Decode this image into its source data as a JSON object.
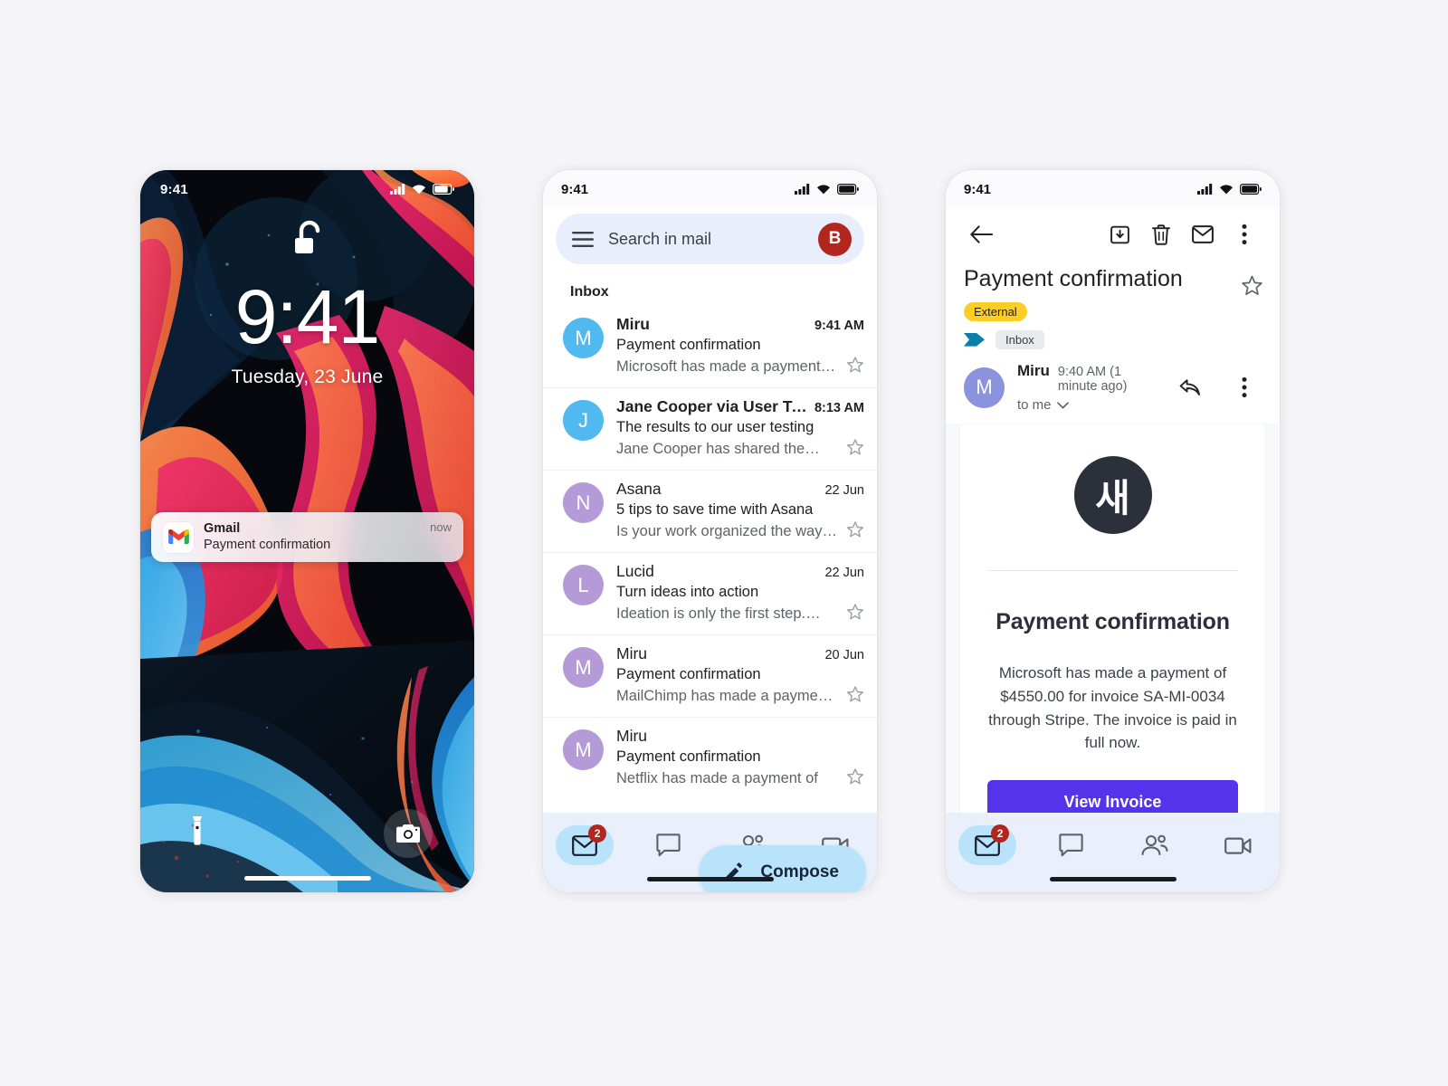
{
  "canvas": {
    "background": "#f5f5f8"
  },
  "phone_lock": {
    "name": "lock-screen",
    "status": {
      "time": "9:41",
      "icons": [
        "cellular-icon",
        "wifi-icon",
        "battery-icon"
      ]
    },
    "lock_icon": "unlocked-padlock-icon",
    "clock": "9:41",
    "date": "Tuesday, 23 June",
    "notification": {
      "app": "Gmail",
      "app_icon": "gmail-icon",
      "title": "Payment confirmation",
      "time": "now"
    },
    "shortcuts": {
      "left": "flashlight-icon",
      "right": "camera-icon"
    }
  },
  "phone_inbox": {
    "name": "gmail-inbox",
    "status": {
      "time": "9:41",
      "icons": [
        "cellular-icon",
        "wifi-icon",
        "battery-icon"
      ]
    },
    "search": {
      "menu_icon": "hamburger-menu-icon",
      "placeholder": "Search in mail",
      "avatar_initial": "B",
      "avatar_color": "#b3261e"
    },
    "section_label": "Inbox",
    "emails": [
      {
        "sender": "Miru",
        "time": "9:41 AM",
        "subject": "Payment confirmation",
        "snippet": "Microsoft has made a payment o…",
        "initial": "M",
        "avatar_color": "#4fb9f0",
        "unread": true,
        "starred": false
      },
      {
        "sender": "Jane Cooper via User Te…",
        "time": "8:13 AM",
        "subject": "The results to our user testing",
        "snippet": "Jane Cooper has shared the…",
        "initial": "J",
        "avatar_color": "#4fb9f0",
        "unread": true,
        "starred": false
      },
      {
        "sender": "Asana",
        "time": "22 Jun",
        "subject": "5 tips to save time with Asana",
        "snippet": "Is your work organized the way…",
        "initial": "N",
        "avatar_color": "#b49bd8",
        "unread": false,
        "starred": false
      },
      {
        "sender": "Lucid",
        "time": "22 Jun",
        "subject": "Turn ideas into action",
        "snippet": "Ideation is only the first step.…",
        "initial": "L",
        "avatar_color": "#b49bd8",
        "unread": false,
        "starred": false
      },
      {
        "sender": "Miru",
        "time": "20 Jun",
        "subject": "Payment confirmation",
        "snippet": "MailChimp has made a payment…",
        "initial": "M",
        "avatar_color": "#b49bd8",
        "unread": false,
        "starred": false
      },
      {
        "sender": "Miru",
        "time": "",
        "subject": "Payment confirmation",
        "snippet": "Netflix has made a payment of",
        "initial": "M",
        "avatar_color": "#b49bd8",
        "unread": false,
        "starred": false
      }
    ],
    "compose": {
      "label": "Compose",
      "icon": "pencil-icon",
      "color": "#b9e3fb"
    },
    "bottom_nav": [
      {
        "icon": "mail-icon",
        "active": true,
        "badge": "2"
      },
      {
        "icon": "chat-icon",
        "active": false,
        "badge": ""
      },
      {
        "icon": "spaces-icon",
        "active": false,
        "badge": ""
      },
      {
        "icon": "meet-icon",
        "active": false,
        "badge": ""
      }
    ]
  },
  "phone_detail": {
    "name": "gmail-email-detail",
    "status": {
      "time": "9:41",
      "icons": [
        "cellular-icon",
        "wifi-icon",
        "battery-icon"
      ]
    },
    "toolbar": {
      "back_icon": "back-arrow-icon",
      "archive_icon": "archive-icon",
      "delete_icon": "trash-icon",
      "unread_icon": "mark-unread-icon",
      "more_icon": "more-vertical-icon"
    },
    "subject": "Payment confirmation",
    "external_badge": "External",
    "star_icon": "star-outline-icon",
    "important_icon": "important-marker-icon",
    "label_chip": "Inbox",
    "sender": {
      "name": "Miru",
      "initial": "M",
      "avatar_color": "#8b93dd",
      "time": "9:40 AM (1 minute ago)",
      "recipient": "to me",
      "expand_icon": "chevron-down-icon",
      "reply_icon": "reply-icon",
      "more_icon": "more-vertical-icon"
    },
    "message": {
      "logo_glyph": "새",
      "logo_color": "#2b303a",
      "title": "Payment confirmation",
      "body": "Microsoft has made a payment of $4550.00 for invoice SA-MI-0034 through Stripe. The invoice is paid in full now.",
      "button_label": "View Invoice",
      "button_color": "#5433eb"
    },
    "bottom_nav": [
      {
        "icon": "mail-icon",
        "active": true,
        "badge": "2"
      },
      {
        "icon": "chat-icon",
        "active": false,
        "badge": ""
      },
      {
        "icon": "spaces-icon",
        "active": false,
        "badge": ""
      },
      {
        "icon": "meet-icon",
        "active": false,
        "badge": ""
      }
    ]
  }
}
